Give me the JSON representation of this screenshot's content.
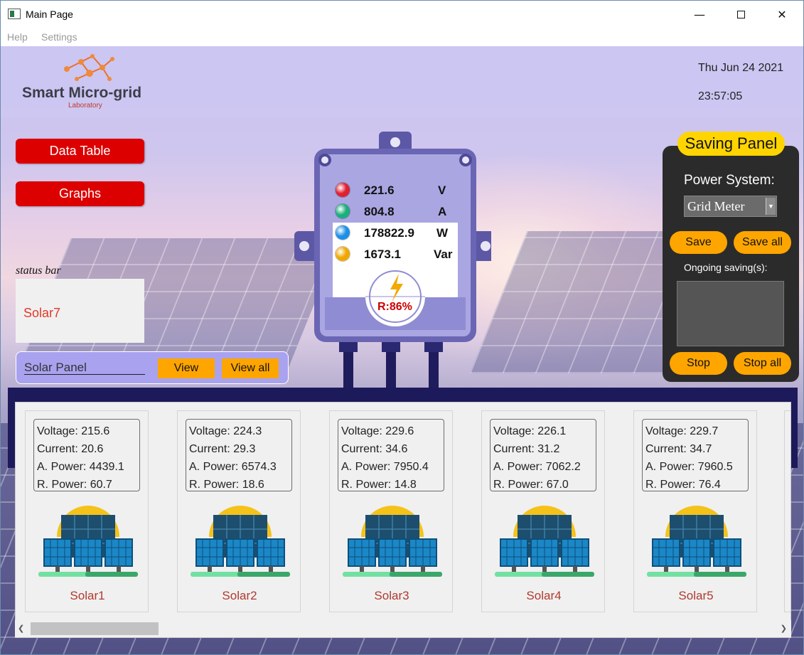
{
  "window": {
    "title": "Main Page"
  },
  "menu": {
    "help": "Help",
    "settings": "Settings"
  },
  "header": {
    "logo_title": "Smart Micro-grid",
    "logo_subtitle": "Laboratory",
    "date": "Thu Jun 24 2021",
    "time": "23:57:05"
  },
  "nav": {
    "data_table": "Data Table",
    "graphs": "Graphs"
  },
  "status": {
    "label": "status bar",
    "text": "Solar7"
  },
  "solar_bar": {
    "select_value": "Solar Panel",
    "view": "View",
    "view_all": "View all"
  },
  "meter": {
    "readings": [
      {
        "value": "221.6",
        "unit": "V",
        "color": "#e02030"
      },
      {
        "value": "804.8",
        "unit": "A",
        "color": "#19b07a"
      },
      {
        "value": "178822.9",
        "unit": "W",
        "color": "#1d8fe8"
      },
      {
        "value": "1673.1",
        "unit": "Var",
        "color": "#f0a800"
      }
    ],
    "ratio": "R:86%"
  },
  "saving_panel": {
    "title": "Saving Panel",
    "power_system_label": "Power System:",
    "power_system_value": "Grid Meter",
    "save": "Save",
    "save_all": "Save all",
    "ongoing_label": "Ongoing saving(s):",
    "stop": "Stop",
    "stop_all": "Stop all"
  },
  "solars": [
    {
      "name": "Solar1",
      "voltage": "Voltage: 215.6",
      "current": "Current: 20.6",
      "a_power": "A. Power: 4439.1",
      "r_power": "R. Power: 60.7"
    },
    {
      "name": "Solar2",
      "voltage": "Voltage: 224.3",
      "current": "Current: 29.3",
      "a_power": "A. Power: 6574.3",
      "r_power": "R. Power: 18.6"
    },
    {
      "name": "Solar3",
      "voltage": "Voltage: 229.6",
      "current": "Current: 34.6",
      "a_power": "A. Power: 7950.4",
      "r_power": "R. Power: 14.8"
    },
    {
      "name": "Solar4",
      "voltage": "Voltage: 226.1",
      "current": "Current: 31.2",
      "a_power": "A. Power: 7062.2",
      "r_power": "R. Power: 67.0"
    },
    {
      "name": "Solar5",
      "voltage": "Voltage: 229.7",
      "current": "Current: 34.7",
      "a_power": "A. Power: 7960.5",
      "r_power": "R. Power: 76.4"
    }
  ],
  "icons": {
    "minimize": "minimize-icon",
    "maximize": "maximize-icon",
    "close": "close-icon",
    "dropdown": "chevron-down-icon",
    "bolt": "lightning-icon",
    "scroll_left": "chevron-left-icon",
    "scroll_right": "chevron-right-icon"
  }
}
